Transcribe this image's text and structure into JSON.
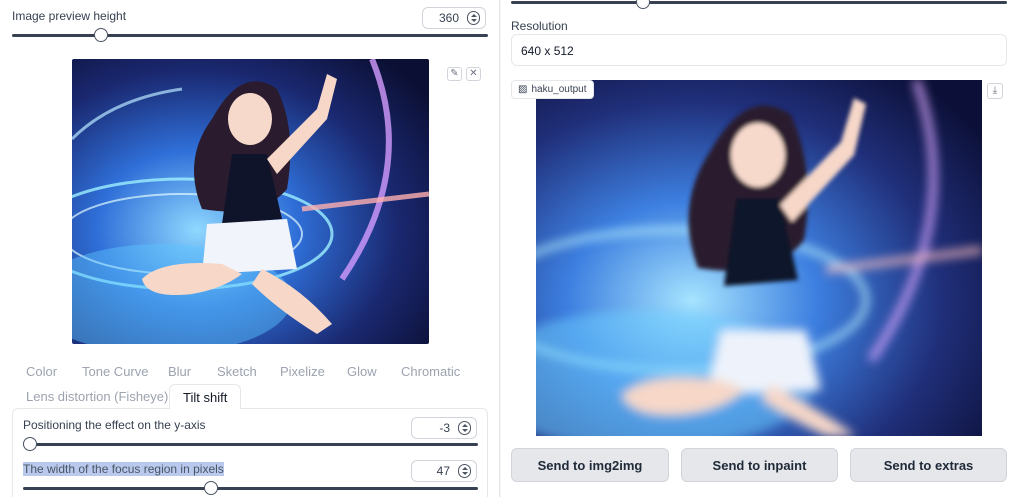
{
  "left": {
    "preview_height_label": "Image preview height",
    "preview_height_value": "360",
    "preview_height_fraction": 0.2,
    "tabs": [
      {
        "label": "Color"
      },
      {
        "label": "Tone Curve"
      },
      {
        "label": "Blur"
      },
      {
        "label": "Sketch"
      },
      {
        "label": "Pixelize"
      },
      {
        "label": "Glow"
      },
      {
        "label": "Chromatic"
      },
      {
        "label": "Lens distortion (Fisheye)"
      },
      {
        "label": "Tilt shift"
      }
    ],
    "active_tab": "Tilt shift",
    "tilt": {
      "y_label": "Positioning the effect on the y-axis",
      "y_value": "-3",
      "y_fraction": 0.02,
      "width_label": "The width of the focus region in pixels",
      "width_value": "47",
      "width_fraction": 0.4
    },
    "edit_icon": "pencil-icon",
    "close_icon": "close-icon"
  },
  "right": {
    "resolution_label": "Resolution",
    "resolution_value": "640 x 512",
    "output_label": "haku_output",
    "download_icon": "download-icon",
    "buttons": {
      "img2img": "Send to img2img",
      "inpaint": "Send to inpaint",
      "extras": "Send to extras"
    }
  },
  "colors": {
    "accent": "#374151",
    "highlight": "#b9c9ee"
  }
}
